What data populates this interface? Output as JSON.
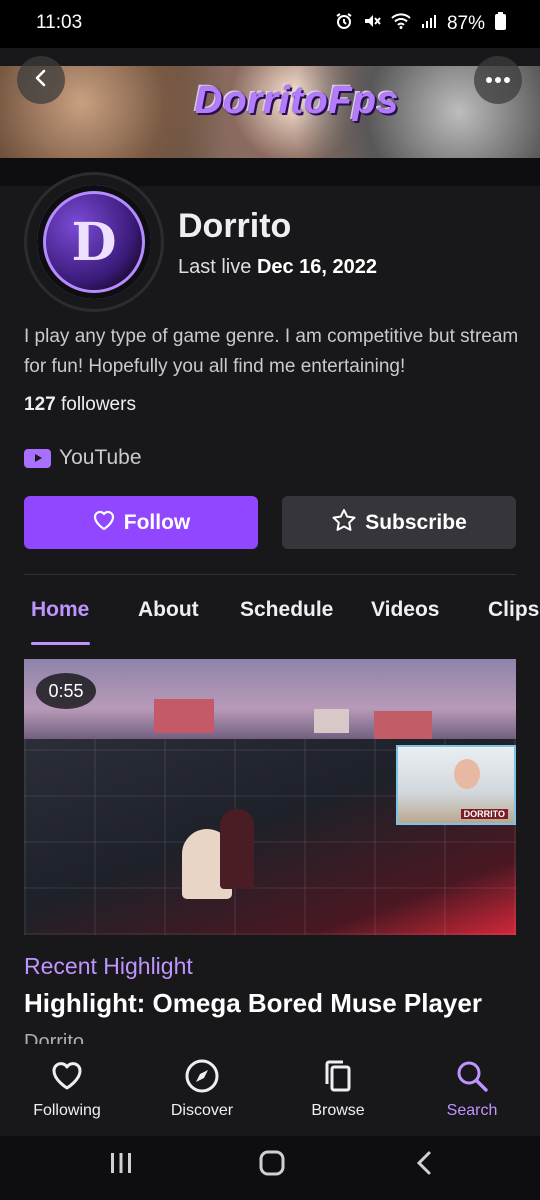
{
  "status_bar": {
    "time": "11:03",
    "battery": "87%"
  },
  "banner": {
    "title": "DorritoFps"
  },
  "profile": {
    "avatar_letter": "D",
    "name": "Dorrito",
    "last_live_prefix": "Last live",
    "last_live_date": "Dec 16, 2022",
    "bio": "I play any type of game genre. I am competitive but stream for fun! Hopefully you all find me entertaining!",
    "followers_count": "127",
    "followers_label": "followers",
    "social_link": "YouTube"
  },
  "actions": {
    "follow_label": "Follow",
    "subscribe_label": "Subscribe"
  },
  "tabs": [
    {
      "label": "Home",
      "active": true
    },
    {
      "label": "About"
    },
    {
      "label": "Schedule"
    },
    {
      "label": "Videos"
    },
    {
      "label": "Clips"
    }
  ],
  "featured": {
    "duration": "0:55",
    "overlay_label": "DORRITO",
    "section_label": "Recent Highlight",
    "title": "Highlight: Omega Bored Muse Player",
    "channel": "Dorrito"
  },
  "bottom_nav": [
    {
      "label": "Following",
      "icon": "heart-icon"
    },
    {
      "label": "Discover",
      "icon": "compass-icon"
    },
    {
      "label": "Browse",
      "icon": "browse-icon"
    },
    {
      "label": "Search",
      "icon": "search-icon",
      "active": true
    }
  ],
  "colors": {
    "accent": "#9147ff",
    "accent_light": "#bf94ff",
    "background": "#18181b"
  }
}
